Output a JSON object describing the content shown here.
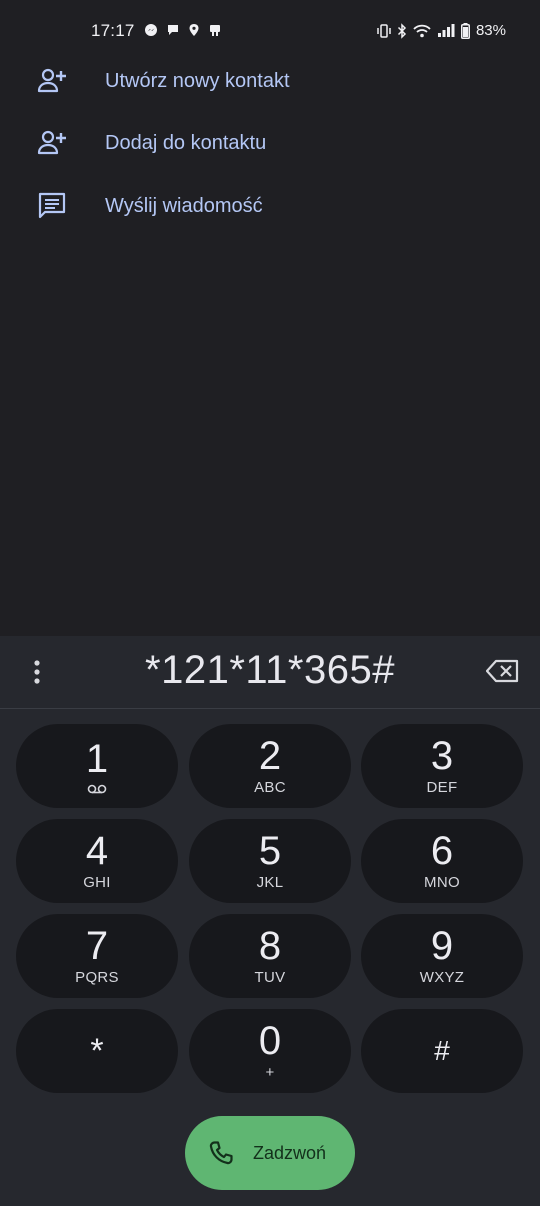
{
  "status_bar": {
    "time": "17:17",
    "battery": "83%",
    "left_icons": [
      "messenger-icon",
      "chat-bubble-icon",
      "location-icon",
      "notification-icon"
    ],
    "right_icons": [
      "vibrate-icon",
      "bluetooth-icon",
      "wifi-icon",
      "signal-icon",
      "battery-icon"
    ]
  },
  "actions": [
    {
      "label": "Utwórz nowy kontakt",
      "icon": "person-add-icon"
    },
    {
      "label": "Dodaj do kontaktu",
      "icon": "person-add-icon"
    },
    {
      "label": "Wyślij wiadomość",
      "icon": "message-icon"
    }
  ],
  "dialer": {
    "number": "*121*11*365#",
    "keys": [
      {
        "digit": "1",
        "letters": "",
        "sub_icon": "voicemail-icon"
      },
      {
        "digit": "2",
        "letters": "ABC"
      },
      {
        "digit": "3",
        "letters": "DEF"
      },
      {
        "digit": "4",
        "letters": "GHI"
      },
      {
        "digit": "5",
        "letters": "JKL"
      },
      {
        "digit": "6",
        "letters": "MNO"
      },
      {
        "digit": "7",
        "letters": "PQRS"
      },
      {
        "digit": "8",
        "letters": "TUV"
      },
      {
        "digit": "9",
        "letters": "WXYZ"
      },
      {
        "digit": "*",
        "letters": ""
      },
      {
        "digit": "0",
        "letters": "+"
      },
      {
        "digit": "#",
        "letters": ""
      }
    ],
    "call_label": "Zadzwoń"
  },
  "colors": {
    "background": "#1f1f23",
    "accent_text": "#b4c7f5",
    "call_button": "#5fb672",
    "key_background": "#17181c"
  }
}
